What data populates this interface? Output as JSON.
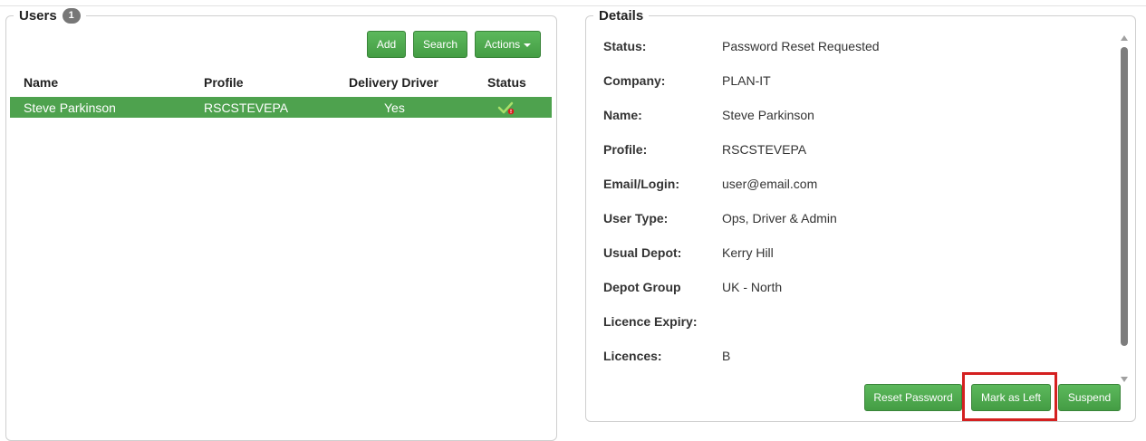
{
  "users_panel": {
    "title": "Users",
    "count": "1",
    "toolbar": {
      "add_label": "Add",
      "search_label": "Search",
      "actions_label": "Actions"
    },
    "columns": [
      "Name",
      "Profile",
      "Delivery Driver",
      "Status"
    ],
    "rows": [
      {
        "name": "Steve Parkinson",
        "profile": "RSCSTEVEPA",
        "delivery_driver": "Yes",
        "status_icon": "check-with-warning-icon"
      }
    ]
  },
  "details_panel": {
    "title": "Details",
    "fields": [
      {
        "label": "Status:",
        "value": "Password Reset Requested"
      },
      {
        "label": "Company:",
        "value": "PLAN-IT"
      },
      {
        "label": "Name:",
        "value": "Steve Parkinson"
      },
      {
        "label": "Profile:",
        "value": "RSCSTEVEPA"
      },
      {
        "label": "Email/Login:",
        "value": "user@email.com"
      },
      {
        "label": "User Type:",
        "value": "Ops, Driver & Admin"
      },
      {
        "label": "Usual Depot:",
        "value": "Kerry Hill"
      },
      {
        "label": "Depot Group",
        "value": "UK - North"
      },
      {
        "label": "Licence Expiry:",
        "value": ""
      },
      {
        "label": "Licences:",
        "value": "B"
      }
    ],
    "buttons": {
      "reset_password_label": "Reset Password",
      "mark_as_left_label": "Mark as Left",
      "suspend_label": "Suspend"
    }
  },
  "colors": {
    "button_green": "#5cb85c",
    "selected_row_green": "#4ea24e",
    "highlight_red": "#d42020",
    "badge_gray": "#777777"
  }
}
